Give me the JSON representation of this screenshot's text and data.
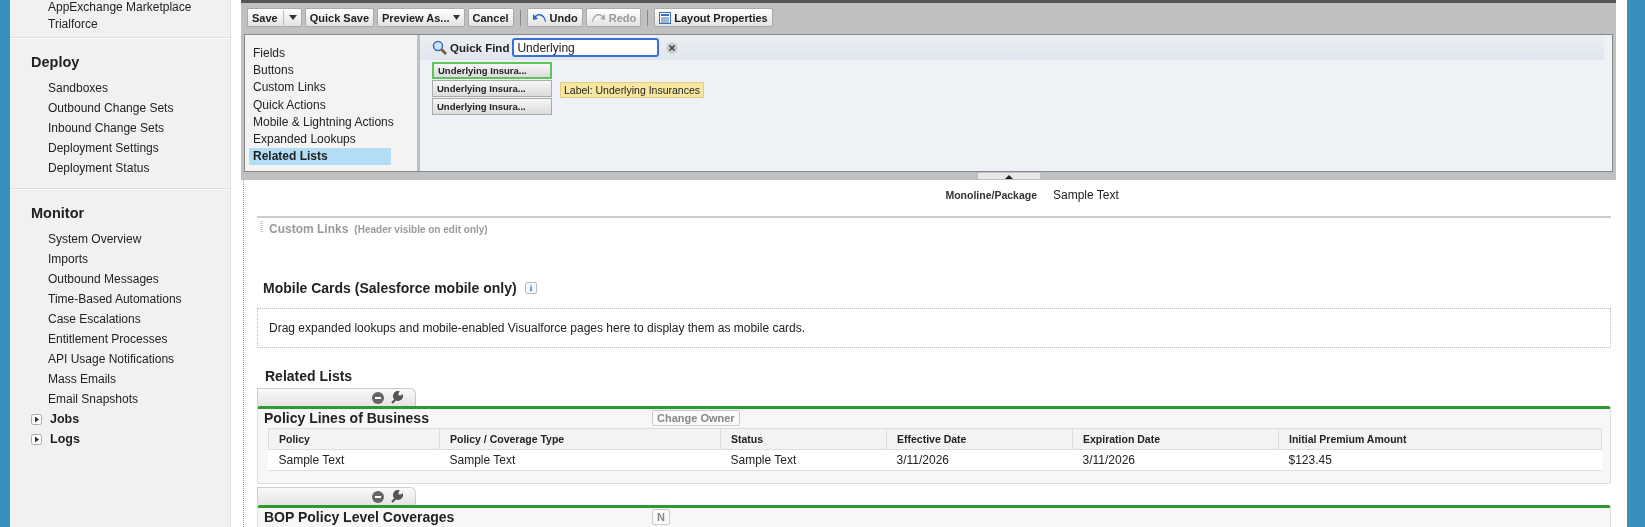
{
  "sidebar": {
    "items": [
      {
        "label": "AppExchange Marketplace"
      },
      {
        "label": "Trialforce"
      }
    ],
    "sections": [
      {
        "title": "Deploy",
        "items": [
          "Sandboxes",
          "Outbound Change Sets",
          "Inbound Change Sets",
          "Deployment Settings",
          "Deployment Status"
        ]
      },
      {
        "title": "Monitor",
        "items": [
          "System Overview",
          "Imports",
          "Outbound Messages",
          "Time-Based Automations",
          "Case Escalations",
          "Entitlement Processes",
          "API Usage Notifications",
          "Mass Emails",
          "Email Snapshots"
        ],
        "folders": [
          {
            "label": "Jobs",
            "expanded": false
          },
          {
            "label": "Logs",
            "expanded": false
          }
        ]
      }
    ]
  },
  "toolbar": [
    {
      "kind": "split",
      "label": "Save",
      "disabled": false
    },
    {
      "kind": "button",
      "label": "Quick Save",
      "disabled": false
    },
    {
      "kind": "dropdown",
      "label": "Preview As...",
      "disabled": false
    },
    {
      "kind": "button",
      "label": "Cancel",
      "disabled": false
    },
    {
      "kind": "separator"
    },
    {
      "kind": "undo",
      "label": "Undo",
      "disabled": false
    },
    {
      "kind": "redo",
      "label": "Redo",
      "disabled": true
    },
    {
      "kind": "separator"
    },
    {
      "kind": "properties",
      "label": "Layout Properties",
      "disabled": false
    }
  ],
  "palette": {
    "categories": [
      {
        "label": "Fields",
        "selected": false
      },
      {
        "label": "Buttons",
        "selected": false
      },
      {
        "label": "Custom Links",
        "selected": false
      },
      {
        "label": "Quick Actions",
        "selected": false
      },
      {
        "label": "Mobile & Lightning Actions",
        "selected": false
      },
      {
        "label": "Expanded Lookups",
        "selected": false
      },
      {
        "label": "Related Lists",
        "selected": true
      }
    ],
    "quick_find": {
      "label": "Quick Find",
      "value": "Underlying"
    },
    "results": [
      {
        "label": "Underlying Insura...",
        "selected": true
      },
      {
        "label": "Underlying Insura...",
        "selected": false
      },
      {
        "label": "Underlying Insura...",
        "selected": false
      }
    ],
    "tooltip": "Label: Underlying Insurances"
  },
  "layout": {
    "field": {
      "label": "Monoline/Package",
      "value": "Sample Text"
    },
    "custom_links": {
      "title": "Custom Links",
      "note": "(Header visible on edit only)"
    },
    "mobile_cards": {
      "title": "Mobile Cards (Salesforce mobile only)",
      "info": "i",
      "hint": "Drag expanded lookups and mobile-enabled Visualforce pages here to display them as mobile cards."
    },
    "related_lists": {
      "title": "Related Lists",
      "lists": [
        {
          "title": "Policy Lines of Business",
          "buttons": [
            "Change Owner"
          ],
          "columns": [
            "Policy",
            "Policy / Coverage Type",
            "Status",
            "Effective Date",
            "Expiration Date",
            "Initial Premium Amount"
          ],
          "rows": [
            [
              "Sample Text",
              "Sample Text",
              "Sample Text",
              "3/11/2026",
              "3/11/2026",
              "$123.45"
            ]
          ]
        },
        {
          "title": "BOP Policy Level Coverages",
          "buttons": [
            "N"
          ]
        }
      ]
    }
  }
}
